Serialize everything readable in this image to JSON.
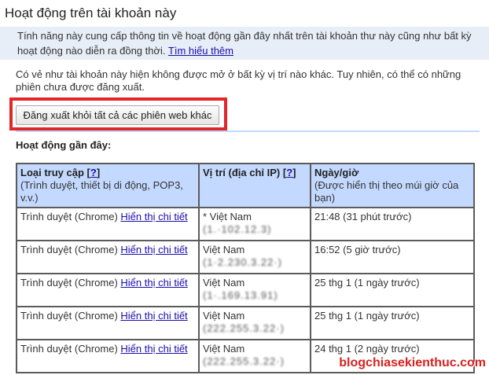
{
  "page": {
    "title": "Hoạt động trên tài khoản này",
    "intro_text": "Tính năng này cung cấp thông tin về hoạt động gần đây nhất trên tài khoản thư này cũng như bất kỳ hoạt động nào diễn ra đồng thời.",
    "learn_more": "Tìm hiểu thêm",
    "note": "Có vẻ như tài khoản này hiện không được mở ở bất kỳ vị trí nào khác. Tuy nhiên, có thể có những phiên chưa được đăng xuất.",
    "logout_button": "Đăng xuất khỏi tất cả các phiên web khác",
    "recent_heading": "Hoạt động gần đây:"
  },
  "table": {
    "headers": {
      "col1_main": "Loại truy cập [",
      "col1_help": "?",
      "col1_close": "]",
      "col1_sub": "(Trình duyệt, thiết bị di động, POP3, v.v.)",
      "col2_main": "Vị trí (địa chỉ IP) [",
      "col2_help": "?",
      "col2_close": "]",
      "col3_main": "Ngày/giờ",
      "col3_sub": "(Được hiển thị theo múi giờ của bạn)"
    },
    "rows": [
      {
        "type": "Trình duyệt (Chrome)",
        "link": "Hiển thị chi tiết",
        "location": "* Việt Nam",
        "ip": "(1.·102.12.3)",
        "time": "21:48 (31 phút trước)"
      },
      {
        "type": "Trình duyệt (Chrome)",
        "link": "Hiển thị chi tiết",
        "location": "Việt Nam",
        "ip": "(1·2.230.3.22·)",
        "time": "16:52 (5 giờ trước)"
      },
      {
        "type": "Trình duyệt (Chrome)",
        "link": "Hiển thị chi tiết",
        "location": "Việt Nam",
        "ip": "(1·.169.13.91)",
        "time": "25 thg 1 (1 ngày trước)"
      },
      {
        "type": "Trình duyệt (Chrome)",
        "link": "Hiển thị chi tiết",
        "location": "Việt Nam",
        "ip": "(222.255.3.22·)",
        "time": "25 thg 1 (1 ngày trước)"
      },
      {
        "type": "Trình duyệt (Chrome)",
        "link": "Hiển thị chi tiết",
        "location": "Việt Nam",
        "ip": "(222.255.3.22·)",
        "time": "24 thg 1 (2 ngày trước)"
      }
    ]
  },
  "watermark": "blogchiasekienthuc.com",
  "colors": {
    "intro_bg": "#e8eef7",
    "header_bg": "#c3d9ff",
    "highlight": "#e2262a",
    "link": "#1a0dab"
  }
}
